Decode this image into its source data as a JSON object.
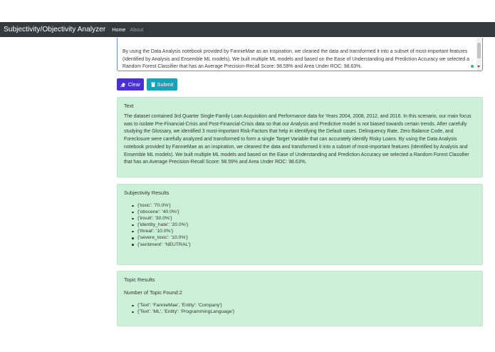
{
  "navbar": {
    "brand": "Subjectivity/Objectivity Analyzer",
    "links": [
      "Home",
      "About"
    ]
  },
  "input": {
    "value": "By using the Data Analysis notebook provided by FannieMae as an inspiration, we cleaned the data and transformed it into a subset of most-important features (Identified by Analysis and Ensemble ML models). We built multiple ML models and based on the Ease of Understanding and Prediction Accuracy we selected a Random Forest Classifier that has an Average Precision-Recall Score: 98.59% and Area Under ROC: 98.63%."
  },
  "buttons": {
    "clear": "Clear",
    "submit": "Submit"
  },
  "text_card": {
    "title": "Text",
    "body": "The dataset contained 3rd Quarter Single-Family Loan Acquisition and Performance data for Years 2004, 2008, 2012, and 2016. In this scenario, our main focus was to isolate Pre-Financial-Crisis and Post-Financial-Crisis data so that our Analysis and Predictive model is not biased towards certain trends. After carefully studying the Glossary, we identified 3 most-important Risk-Factors that help in identifying the Default cases. Delinquency Rate, Zero Balance Code, and Foreclosure were carefully analyzed and transformed to form a single Target Variable that can accurately identify Risky Loans. By using the Data Analysis notebook provided by FannieMae as an inspiration, we cleaned the data and transformed it into a subset of most-important features (Identified by Analysis and Ensemble ML models). We built multiple ML models and based on the Ease of Understanding and Prediction Accuracy we selected a Random Forest Classifier that has an Average Precision-Recall Score: 98.59% and Area Under ROC: 98.63%."
  },
  "subjectivity_card": {
    "title": "Subjectivity Results",
    "items": [
      "{'toxic': '70.0%'}",
      "{'obscene': '40.0%'}",
      "{'insult': '30.0%'}",
      "{'identity_hate': '20.0%'}",
      "{'threat': '10.0%'}",
      "{'severe_toxic': '10.0%'}",
      "{'sentiment': 'NEUTRAL'}"
    ]
  },
  "topic_card": {
    "title": "Topic Results",
    "count_text": "Number of Topic Found:2",
    "items": [
      "{'Text': 'FannieMae', 'Entity': 'Company'}",
      "{'Text': 'ML', 'Entity': 'ProgrammingLanguage'}"
    ]
  },
  "colors": {
    "navbar": "#343a40",
    "clear_button": "#4a2fd6",
    "submit_button": "#17a2b8",
    "card_background": "#cdf0d8"
  },
  "icons": {
    "clear": "eraser-icon",
    "submit": "trash-icon"
  }
}
